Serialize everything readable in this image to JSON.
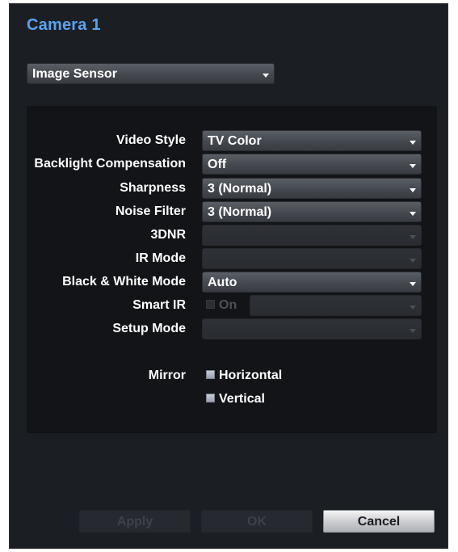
{
  "window": {
    "title": "Camera 1"
  },
  "section_select": {
    "value": "Image Sensor"
  },
  "settings": {
    "video_style": {
      "label": "Video Style",
      "value": "TV Color"
    },
    "backlight": {
      "label": "Backlight Compensation",
      "value": "Off"
    },
    "sharpness": {
      "label": "Sharpness",
      "value": "3 (Normal)"
    },
    "noise_filter": {
      "label": "Noise Filter",
      "value": "3 (Normal)"
    },
    "dnr": {
      "label": "3DNR",
      "value": ""
    },
    "ir_mode": {
      "label": "IR Mode",
      "value": ""
    },
    "bw_mode": {
      "label": "Black & White Mode",
      "value": "Auto"
    },
    "smart_ir": {
      "label": "Smart IR",
      "checkbox_label": "On",
      "value": ""
    },
    "setup_mode": {
      "label": "Setup Mode",
      "value": ""
    },
    "mirror": {
      "label": "Mirror",
      "horizontal": "Horizontal",
      "vertical": "Vertical"
    }
  },
  "buttons": {
    "apply": "Apply",
    "ok": "OK",
    "cancel": "Cancel"
  },
  "colors": {
    "title_accent": "#5aa2f0",
    "window_bg": "#1b1f24",
    "panel_bg": "#121417"
  },
  "icons": {
    "dropdown": "chevron-down-icon"
  }
}
